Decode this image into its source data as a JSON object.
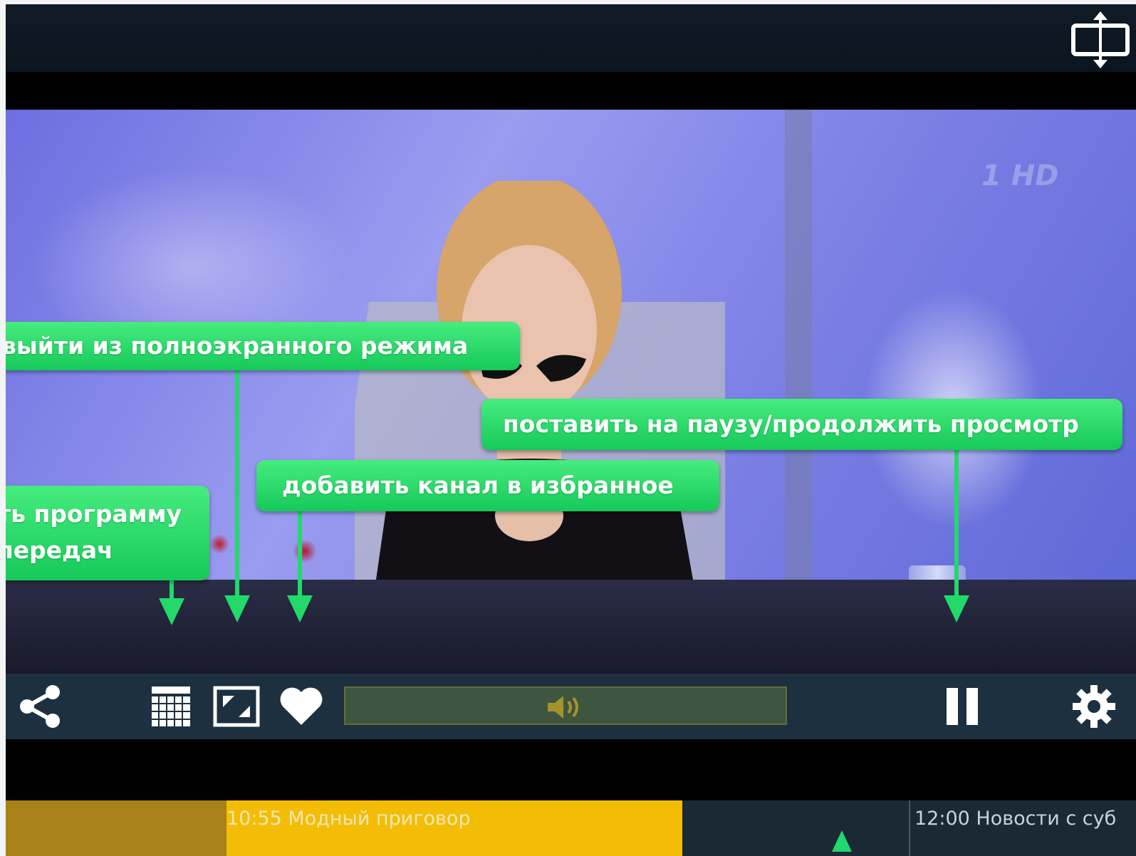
{
  "callouts": {
    "exit_fullscreen": "выйти из полноэкранного режима",
    "pause_resume": "поставить на паузу/продолжить просмотр",
    "add_favorite": "добавить канал в избранное",
    "program_line1": "ть программу",
    "program_line2": "передач"
  },
  "video": {
    "watermark": "1 HD"
  },
  "player": {
    "volume_percent": 0
  },
  "epg": {
    "current": "10:55 Модный приговор",
    "next": "12:00 Новости с суб"
  },
  "colors": {
    "callout_green": "#1fd870",
    "epg_current": "#f3bd05",
    "control_bar": "#1d3040"
  },
  "icons": [
    "fullscreen-toggle-icon",
    "share-icon",
    "calendar-icon",
    "exit-fullscreen-icon",
    "heart-icon",
    "volume-icon",
    "pause-icon",
    "gear-icon"
  ]
}
